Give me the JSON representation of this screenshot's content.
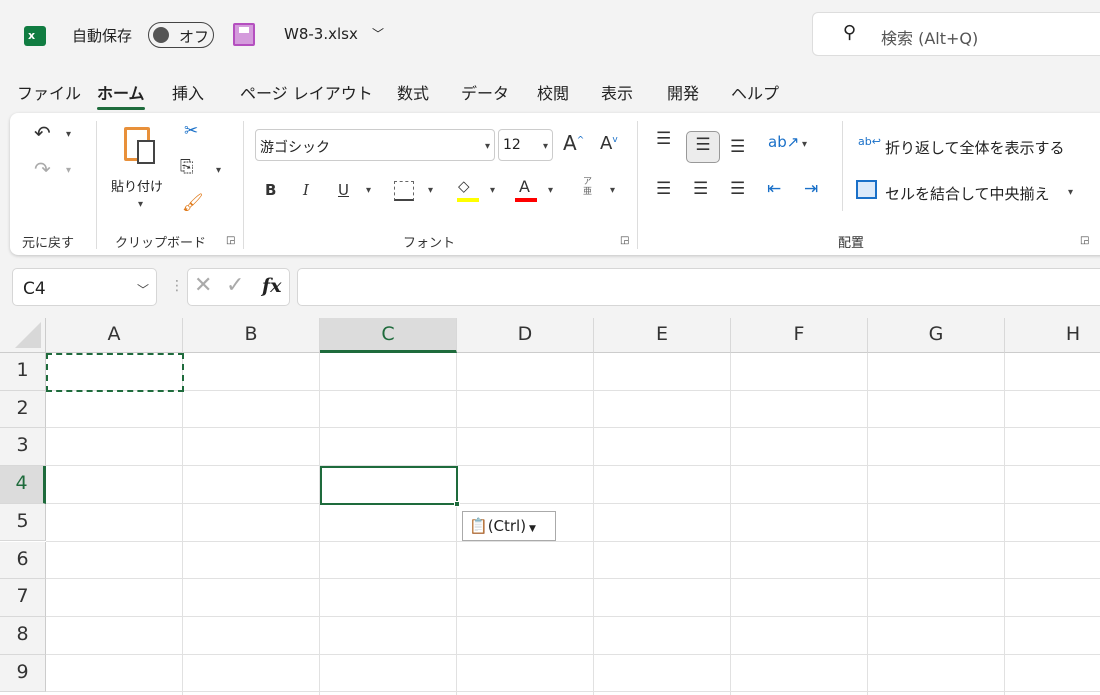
{
  "titlebar": {
    "autosave_label": "自動保存",
    "autosave_state": "オフ",
    "filename": "W8-3.xlsx",
    "search_placeholder": "検索 (Alt+Q)"
  },
  "tabs": [
    "ファイル",
    "ホーム",
    "挿入",
    "ページ レイアウト",
    "数式",
    "データ",
    "校閲",
    "表示",
    "開発",
    "ヘルプ"
  ],
  "active_tab": "ホーム",
  "ribbon": {
    "undo_group": "元に戻す",
    "clipboard": {
      "paste": "貼り付け",
      "group": "クリップボード"
    },
    "font": {
      "name": "游ゴシック",
      "size": "12",
      "bold": "B",
      "italic": "I",
      "underline": "U",
      "font_color_glyph": "A",
      "grow": "A",
      "shrink": "A",
      "phonetic": "ア亜",
      "group": "フォント",
      "fill_color": "#ffff00",
      "font_color": "#ff0000"
    },
    "alignment": {
      "wrap": "折り返して全体を表示する",
      "merge": "セルを結合して中央揃え",
      "group": "配置"
    }
  },
  "formula_bar": {
    "name_box": "C4",
    "fx": "fx",
    "formula": ""
  },
  "sheet": {
    "columns": [
      "A",
      "B",
      "C",
      "D",
      "E",
      "F",
      "G",
      "H"
    ],
    "rows": [
      "1",
      "2",
      "3",
      "4",
      "5",
      "6",
      "7",
      "8",
      "9"
    ],
    "active_cell": "C4",
    "copy_source": "A1"
  },
  "paste_options": {
    "label": "(Ctrl)"
  },
  "colors": {
    "accent": "#1e6b3c",
    "excel_green": "#107c41",
    "save_purple": "#b44fbf"
  }
}
